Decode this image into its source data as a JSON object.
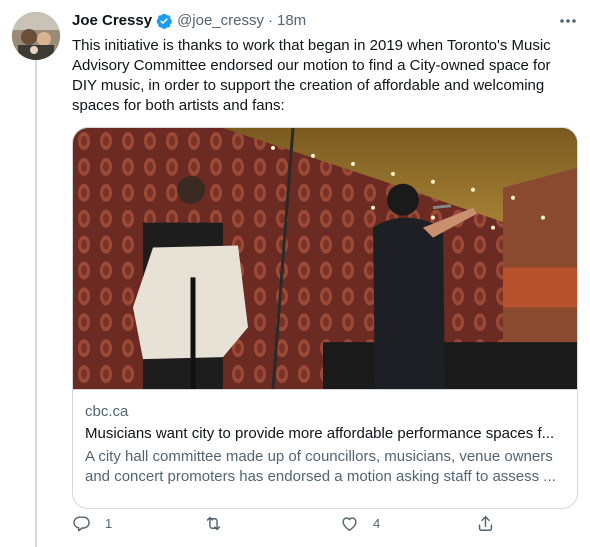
{
  "author": {
    "name": "Joe Cressy",
    "handle": "@joe_cressy",
    "separator": "·",
    "time": "18m"
  },
  "tweet": {
    "text": "This initiative is thanks to work that began in 2019 when Toronto's Music Advisory Committee endorsed our motion to find a City-owned space for DIY music, in order to support the creation of affordable and welcoming spaces for both artists and fans:"
  },
  "card": {
    "domain": "cbc.ca",
    "title": "Musicians want city to provide more affordable performance spaces f...",
    "description": "A city hall committee made up of councillors, musicians, venue owners and concert promoters has endorsed a motion asking staff to assess ..."
  },
  "actions": {
    "reply_count": "1",
    "retweet_count": "",
    "like_count": "4"
  },
  "icons": {
    "verified": "verified-badge-icon",
    "more": "more-options-icon",
    "reply": "reply-icon",
    "retweet": "retweet-icon",
    "like": "like-icon",
    "share": "share-icon"
  },
  "colors": {
    "accent": "#1d9bf0",
    "text": "#0f1419",
    "secondary": "#536471",
    "border": "#cfd9de"
  }
}
